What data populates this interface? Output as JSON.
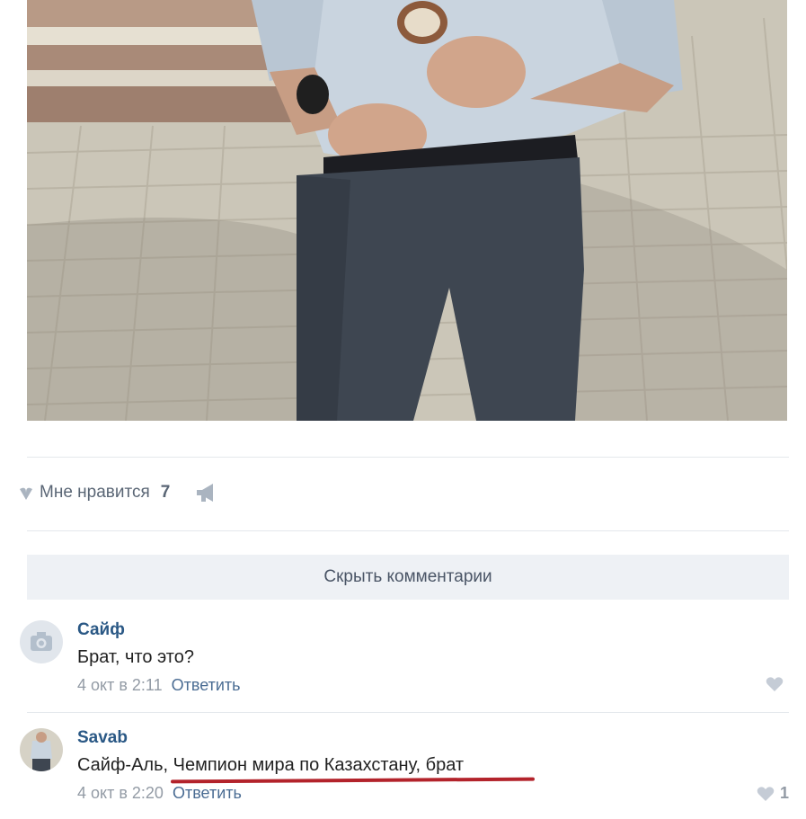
{
  "post": {
    "photo_icon": "post-photo"
  },
  "actions": {
    "like_label": "Мне нравится",
    "like_count": "7",
    "like_icon": "heart-icon",
    "share_icon": "megaphone-icon"
  },
  "hide_comments_label": "Скрыть комментарии",
  "comments": [
    {
      "author": "Сайф",
      "text": "Брат, что это?",
      "time": "4 окт в 2:11",
      "reply_label": "Ответить",
      "likes": "",
      "avatar_icon": "camera-icon"
    },
    {
      "author": "Savab",
      "text": "Сайф-Аль, Чемпион мира по Казахстану, брат",
      "time": "4 окт в 2:20",
      "reply_label": "Ответить",
      "likes": "1",
      "avatar_icon": "user-avatar"
    }
  ],
  "colors": {
    "link": "#2a5885",
    "meta": "#939ba5",
    "button_bg": "#eef1f5",
    "underline": "#b3232b"
  }
}
